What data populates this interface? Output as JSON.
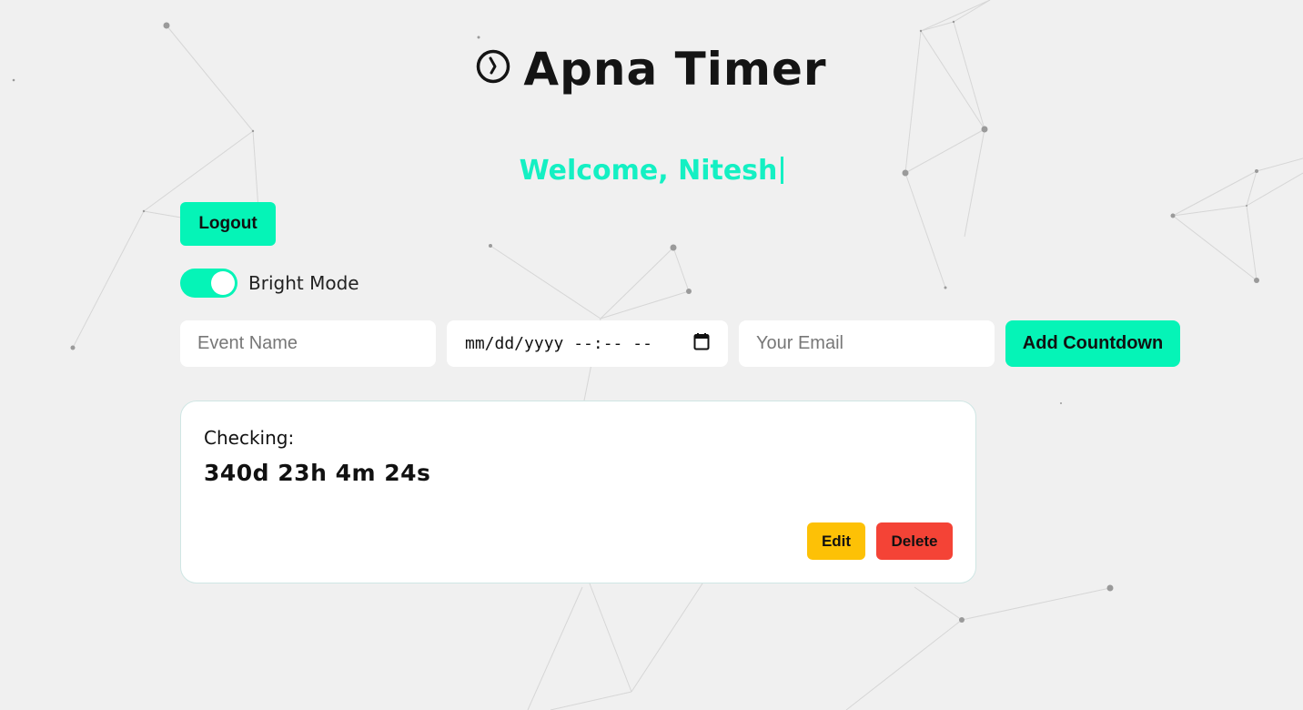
{
  "app": {
    "title": "Apna Timer",
    "welcome": "Welcome, Nitesh"
  },
  "controls": {
    "logout_label": "Logout",
    "theme_toggle_label": "Bright Mode",
    "theme_toggle_on": true
  },
  "form": {
    "event_name_placeholder": "Event Name",
    "datetime_placeholder": "mm/dd/yyyy --:-- --",
    "email_placeholder": "Your Email",
    "add_label": "Add Countdown"
  },
  "countdowns": [
    {
      "name": "Checking:",
      "remaining": "340d 23h 4m 24s",
      "edit_label": "Edit",
      "delete_label": "Delete"
    }
  ],
  "colors": {
    "accent": "#05f4b7",
    "welcome": "#14f0c3",
    "edit": "#fdc106",
    "delete": "#f44336",
    "background": "#f0f0f0"
  },
  "icons": {
    "title_icon": "clock-icon",
    "date_picker_icon": "calendar-icon"
  }
}
